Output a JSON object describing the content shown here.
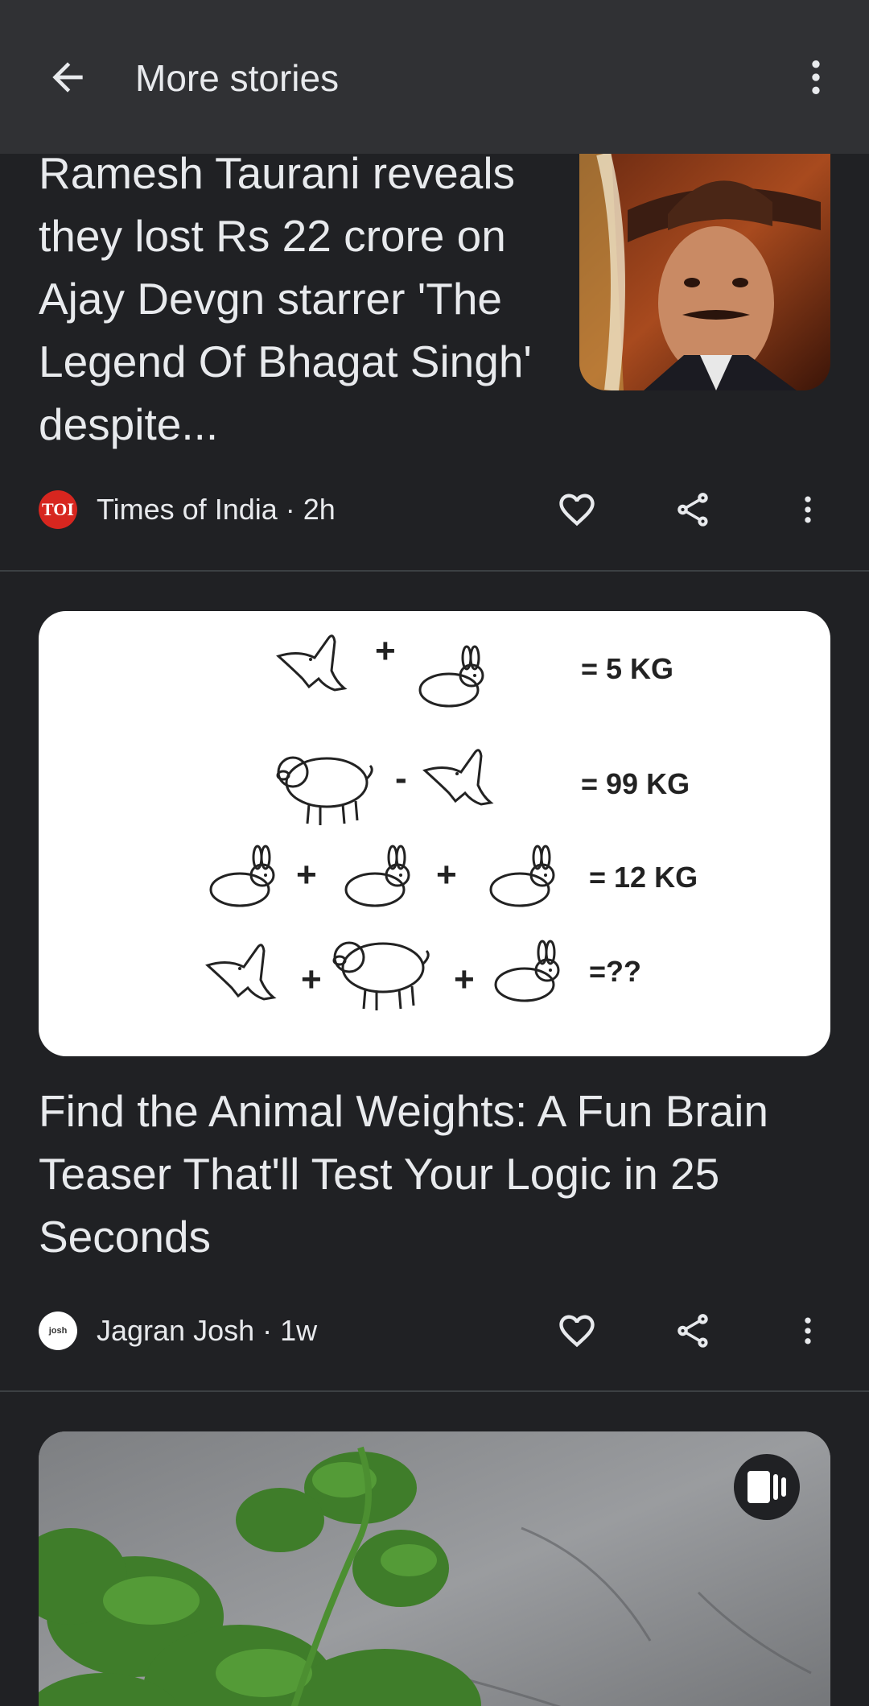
{
  "header": {
    "title": "More stories"
  },
  "stories": [
    {
      "headline": "Ramesh Taurani reveals they lost Rs 22 crore on Ajay Devgn starrer 'The Legend Of Bhagat Singh' despite...",
      "source": "Times of India",
      "age": "2h",
      "source_line": "Times of India · 2h",
      "logo_text": "TOI"
    },
    {
      "headline": "Find the Animal Weights: A Fun Brain Teaser That'll Test Your Logic in 25 Seconds",
      "source": "Jagran Josh",
      "age": "1w",
      "source_line": "Jagran Josh · 1w",
      "logo_text": "josh",
      "puzzle_lines": [
        "= 5 KG",
        "= 99 KG",
        "= 12 KG",
        "=??"
      ]
    }
  ],
  "icons": {
    "back": "arrow-left-icon",
    "menu": "more-vert-icon",
    "like": "heart-outline-icon",
    "share": "share-icon",
    "story": "web-story-icon"
  },
  "colors": {
    "background": "#202124",
    "topbar": "#303134",
    "text": "#e8eaed",
    "toi_red": "#d7261f"
  }
}
